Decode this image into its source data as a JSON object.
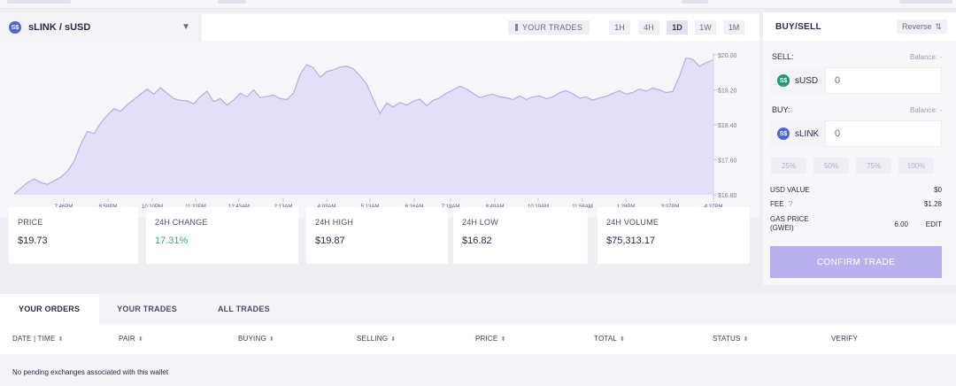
{
  "chart": {
    "pair": "sLINK / sUSD",
    "coin_symbol": "S$",
    "your_trades_label": "YOUR TRADES",
    "timeframes": [
      "1H",
      "4H",
      "1D",
      "1W",
      "1M"
    ],
    "active_timeframe": "1D",
    "color_fill": "#e3dff8",
    "color_line": "#b6addf"
  },
  "chart_data": {
    "type": "area",
    "x_ticks": [
      "7:46PM",
      "8:58PM",
      "10:10PM",
      "11:22PM",
      "12:43AM",
      "2:13AM",
      "4:03AM",
      "5:13AM",
      "6:16AM",
      "7:19AM",
      "8:49AM",
      "10:19AM",
      "11:58AM",
      "1:28PM",
      "3:07PM",
      "4:37PM"
    ],
    "y_ticks": [
      "$20.00",
      "$19.20",
      "$18.40",
      "$17.60",
      "$16.80"
    ],
    "ylim": [
      16.8,
      20.0
    ],
    "values": [
      16.82,
      16.95,
      17.08,
      17.16,
      17.08,
      17.04,
      17.12,
      17.2,
      17.34,
      17.56,
      17.95,
      18.25,
      18.2,
      18.44,
      18.62,
      18.77,
      18.71,
      18.86,
      18.98,
      19.1,
      19.22,
      19.1,
      19.25,
      19.12,
      19.0,
      18.96,
      18.95,
      18.88,
      19.05,
      19.17,
      18.93,
      19.0,
      18.85,
      18.97,
      19.12,
      19.04,
      19.2,
      19.02,
      19.05,
      19.08,
      19.0,
      18.98,
      19.13,
      19.55,
      19.78,
      19.7,
      19.49,
      19.62,
      19.66,
      19.72,
      19.74,
      19.68,
      19.52,
      19.33,
      18.98,
      18.66,
      18.9,
      18.81,
      18.91,
      18.85,
      18.94,
      18.99,
      18.84,
      18.96,
      19.02,
      19.12,
      19.2,
      19.28,
      19.22,
      19.12,
      19.02,
      19.07,
      19.1,
      19.04,
      19.02,
      18.98,
      19.06,
      18.98,
      19.04,
      19.06,
      19.0,
      19.04,
      19.14,
      19.18,
      19.11,
      19.01,
      19.04,
      18.96,
      19.02,
      19.05,
      19.12,
      19.18,
      19.1,
      19.14,
      19.22,
      19.17,
      19.24,
      19.2,
      19.14,
      19.16,
      19.5,
      19.93,
      19.9,
      19.74,
      19.82,
      19.88
    ]
  },
  "stats": [
    {
      "label": "PRICE",
      "value": "$19.73",
      "color": ""
    },
    {
      "label": "24H CHANGE",
      "value": "17.31%",
      "color": "green"
    },
    {
      "label": "24H HIGH",
      "value": "$19.87",
      "color": ""
    },
    {
      "label": "24H LOW",
      "value": "$16.82",
      "color": ""
    },
    {
      "label": "24H VOLUME",
      "value": "$75,313.17",
      "color": ""
    }
  ],
  "buysell": {
    "title": "BUY/SELL",
    "reverse_label": "Reverse",
    "sell_label": "SELL:",
    "buy_label": "BUY:",
    "balance_label": "Balance: -",
    "sell_currency": "sUSD",
    "sell_amount": "0",
    "buy_currency": "sLINK",
    "buy_amount": "0",
    "coin_symbol": "S$",
    "percentages": [
      "25%",
      "50%",
      "75%",
      "100%"
    ],
    "usd_value_label": "USD VALUE",
    "usd_value": "$0",
    "fee_label": "FEE",
    "fee_help": "?",
    "fee_value": "$1.28",
    "gas_label_line1": "GAS PRICE",
    "gas_label_line2": "(GWEI)",
    "gas_value": "6.00",
    "edit_label": "EDIT",
    "confirm_label": "CONFIRM TRADE"
  },
  "orders": {
    "tabs": [
      "YOUR ORDERS",
      "YOUR TRADES",
      "ALL TRADES"
    ],
    "columns": [
      "DATE | TIME",
      "PAIR",
      "BUYING",
      "SELLING",
      "PRICE",
      "TOTAL",
      "STATUS",
      "VERIFY"
    ],
    "sort_glyph": "⬍",
    "empty_message": "No pending exchanges associated with this wallet"
  }
}
